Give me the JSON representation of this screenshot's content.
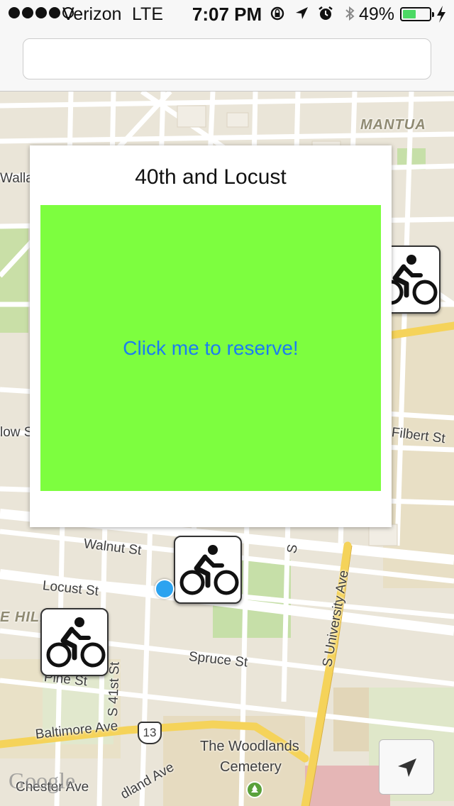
{
  "status_bar": {
    "carrier": "Verizon",
    "network": "LTE",
    "time": "7:07 PM",
    "battery_percent": "49%",
    "battery_level": 0.49,
    "signal_bars_filled": 4,
    "signal_bars_total": 5,
    "icons": [
      "rotation-lock-icon",
      "location-arrow-icon",
      "alarm-icon",
      "bluetooth-icon",
      "charging-bolt-icon"
    ]
  },
  "browser": {
    "url_value": ""
  },
  "map": {
    "labels": {
      "mantua": "MANTUA",
      "walla": "Walla",
      "willow": "low S",
      "filbert": "Filbert St",
      "walnut": "Walnut St",
      "locust": "Locust St",
      "hill": "E HILL",
      "spruce": "Spruce St",
      "pine": "Pine St",
      "s41": "S 41st St",
      "university": "S University Ave",
      "baltimore": "Baltimore Ave",
      "route": "13",
      "woodlands1": "The Woodlands",
      "woodlands2": "Cemetery",
      "chester": "Chester Ave",
      "woodland_ave": "dland Ave",
      "s_st": "S"
    },
    "attribution": "Google",
    "marker_icon": "bicycle-icon",
    "colors": {
      "road_major": "#f5d35a",
      "water_park": "#c6dfa8",
      "background": "#efe9dd"
    }
  },
  "popup": {
    "title": "40th and Locust",
    "reserve_label": "Click me to reserve!",
    "reserve_color": "#7dfe3f",
    "link_color": "#1b7cf2"
  }
}
